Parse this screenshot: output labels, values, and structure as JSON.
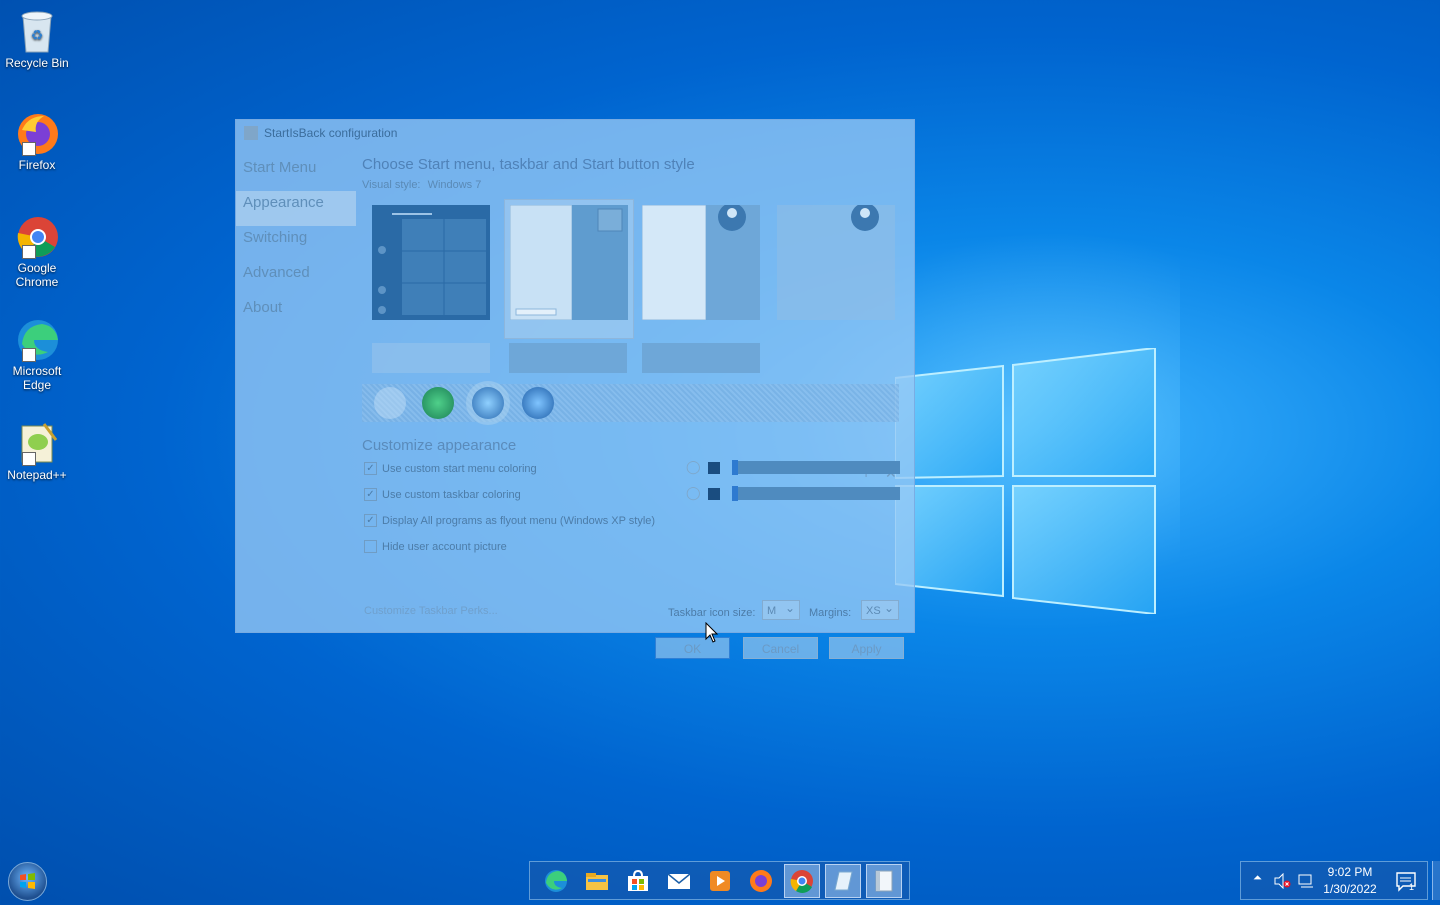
{
  "desktop": {
    "icons": [
      {
        "label": "Recycle Bin",
        "icon": "recycle-bin-icon"
      },
      {
        "label": "Firefox",
        "icon": "firefox-icon"
      },
      {
        "label": "Google Chrome",
        "icon": "chrome-icon"
      },
      {
        "label": "Microsoft Edge",
        "icon": "edge-icon"
      },
      {
        "label": "Notepad++",
        "icon": "notepad-plus-plus-icon"
      }
    ]
  },
  "dialog": {
    "title": "StartIsBack configuration",
    "nav": [
      "Start Menu",
      "Appearance",
      "Switching",
      "Advanced",
      "About"
    ],
    "active_nav": "Appearance",
    "heading": "Choose Start menu, taskbar and Start button style",
    "visual_style_label": "Visual style:",
    "visual_style_value": "Windows 7",
    "customize_heading": "Customize appearance",
    "options": [
      {
        "label": "Use custom start menu coloring",
        "checked": true
      },
      {
        "label": "Use custom taskbar coloring",
        "checked": true
      },
      {
        "label": "Display All programs as flyout menu (Windows XP style)",
        "checked": true
      },
      {
        "label": "Hide user account picture",
        "checked": false
      }
    ],
    "link": "Customize Taskbar Perks...",
    "taskbar_icon_size_label": "Taskbar icon size:",
    "taskbar_icon_size_value": "M",
    "margins_label": "Margins:",
    "margins_value": "XS",
    "buttons": {
      "ok": "OK",
      "cancel": "Cancel",
      "apply": "Apply"
    },
    "colors": {
      "accent": "#2e7ad0",
      "swatch": "#1a4d80"
    }
  },
  "taskbar": {
    "apps": [
      "edge-icon",
      "file-explorer-icon",
      "store-icon",
      "mail-icon",
      "media-player-icon",
      "firefox-icon",
      "chrome-icon",
      "notepad-icon",
      "startisback-icon"
    ],
    "clock_time": "9:02 PM",
    "clock_date": "1/30/2022",
    "notification_count": "1"
  }
}
